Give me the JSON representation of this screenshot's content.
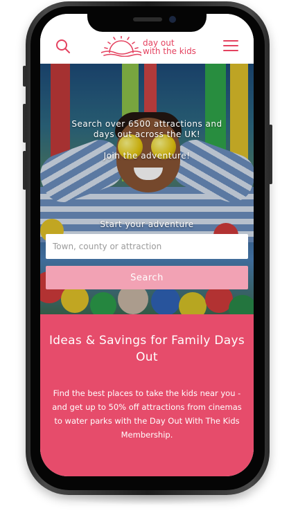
{
  "header": {
    "logo_line1": "day out",
    "logo_line2": "with the kids"
  },
  "hero": {
    "headline_line1": "Search over 6500 attractions and",
    "headline_line2": "days out across the UK!",
    "tagline": "Join the adventure!",
    "search_label": "Start your adventure",
    "search_placeholder": "Town, county or attraction",
    "search_button": "Search"
  },
  "promo": {
    "title": "Ideas & Savings for Family Days Out",
    "body": "Find the best places to take the kids near you - and get up to 50% off attractions from cinemas to water parks with the Day Out With The Kids Membership."
  },
  "colors": {
    "brand": "#e4415f",
    "promo_bg": "#e64c6b",
    "search_button_bg": "#f2a2b4"
  },
  "icons": {
    "search": "search-icon",
    "menu": "hamburger-menu-icon",
    "logo": "sunrise-logo-icon"
  }
}
